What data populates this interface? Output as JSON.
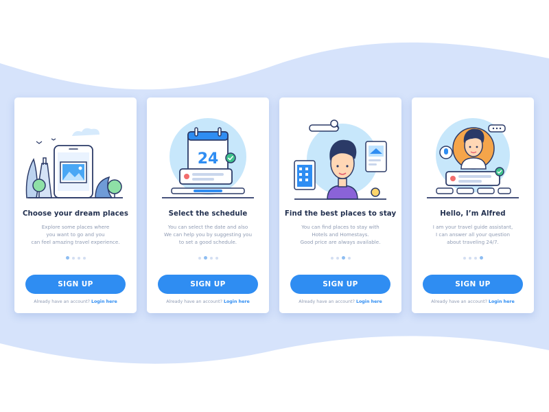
{
  "colors": {
    "background_wave": "#d6e3fb",
    "primary": "#2f8df2",
    "title": "#22304f",
    "muted": "#8f9bb3",
    "dot": "#d3def2",
    "dot_active": "#8dbdf2"
  },
  "cards": [
    {
      "title": "Choose your dream places",
      "description": "Explore some places where\nyou want to go and you\ncan feel amazing travel experience.",
      "active_dot": 1,
      "button": "SIGN UP",
      "login_prompt": "Already have an account?",
      "login_link": "Login here",
      "illustration": "phone-landmark-illustration"
    },
    {
      "title": "Select the schedule",
      "description": "You can select the date and also\nWe can help you by suggesting you\nto set a good schedule.",
      "active_dot": 2,
      "button": "SIGN UP",
      "login_prompt": "Already have an account?",
      "login_link": "Login here",
      "illustration": "calendar-illustration",
      "calendar_day": "24"
    },
    {
      "title": "Find the best places to stay",
      "description": "You can find places to stay with\nHotels and Homestays.\nGood price are always available.",
      "active_dot": 3,
      "button": "SIGN UP",
      "login_prompt": "Already have an account?",
      "login_link": "Login here",
      "illustration": "hotel-search-illustration"
    },
    {
      "title": "Hello, I’m Alfred",
      "description": "I am your travel guide assistant,\nI can answer all your question\nabout traveling 24/7.",
      "active_dot": 4,
      "button": "SIGN UP",
      "login_prompt": "Already have an account?",
      "login_link": "Login here",
      "illustration": "assistant-avatar-illustration"
    }
  ]
}
